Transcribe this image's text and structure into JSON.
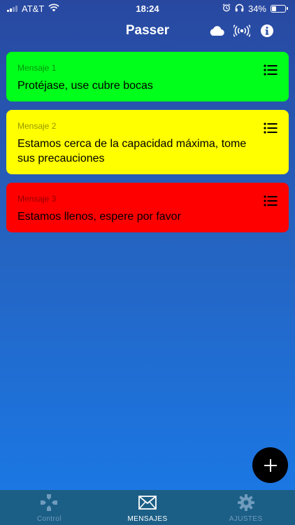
{
  "status_bar": {
    "carrier": "AT&T",
    "time": "18:24",
    "battery_percent": "34%",
    "battery_level": 0.34
  },
  "header": {
    "title": "Passer",
    "icons": [
      "cloud-icon",
      "broadcast-icon",
      "info-icon"
    ]
  },
  "messages": [
    {
      "label": "Mensaje 1",
      "text": "Protéjase, use cubre bocas",
      "color": "#00ff1a"
    },
    {
      "label": "Mensaje 2",
      "text": "Estamos cerca de la capacidad máxima, tome sus precauciones",
      "color": "#ffff00"
    },
    {
      "label": "Mensaje 3",
      "text": "Estamos llenos, espere por favor",
      "color": "#ff0000"
    }
  ],
  "fab": {
    "icon": "plus-icon"
  },
  "tabs": [
    {
      "label": "Control",
      "icon": "gamepad-icon",
      "active": false
    },
    {
      "label": "MENSAJES",
      "icon": "envelope-icon",
      "active": true
    },
    {
      "label": "AJUSTES",
      "icon": "gear-icon",
      "active": false
    }
  ],
  "colors": {
    "tab_bar": "#1c5f86",
    "tab_inactive": "#6f9bbd",
    "tab_active": "#ffffff"
  }
}
